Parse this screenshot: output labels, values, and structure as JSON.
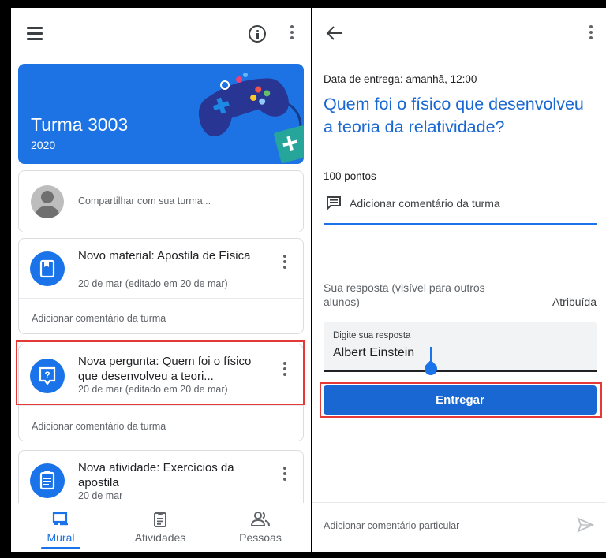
{
  "left": {
    "banner": {
      "title": "Turma 3003",
      "year": "2020"
    },
    "share_prompt": "Compartilhar com sua turma...",
    "posts": [
      {
        "icon": "book-icon",
        "title": "Novo material: Apostila de Física",
        "date": "20 de mar (editado em 20 de mar)",
        "comment": "Adicionar comentário da turma"
      },
      {
        "icon": "question-icon",
        "title": "Nova pergunta: Quem foi o físico que desenvolveu a teori...",
        "date": "20 de mar (editado em 20 de mar)",
        "comment": "Adicionar comentário da turma"
      },
      {
        "icon": "assignment-icon",
        "title": "Nova atividade: Exercícios da apostila",
        "date": "20 de mar"
      }
    ],
    "nav": [
      {
        "label": "Mural",
        "icon": "stream-icon",
        "active": true
      },
      {
        "label": "Atividades",
        "icon": "clipboard-icon",
        "active": false
      },
      {
        "label": "Pessoas",
        "icon": "people-icon",
        "active": false
      }
    ]
  },
  "right": {
    "due": "Data de entrega: amanhã, 12:00",
    "question": "Quem foi o físico que desenvolveu a teoria da relatividade?",
    "points": "100 pontos",
    "class_comment": "Adicionar comentário da turma",
    "your_answer_label": "Sua resposta (visível para outros alunos)",
    "status": "Atribuída",
    "answer": {
      "label": "Digite sua resposta",
      "value": "Albert Einstein"
    },
    "submit_label": "Entregar",
    "private_comment": "Adicionar comentário particular"
  },
  "colors": {
    "accent": "#1a73e8",
    "banner": "#1e73e4",
    "highlight": "#e53935"
  }
}
